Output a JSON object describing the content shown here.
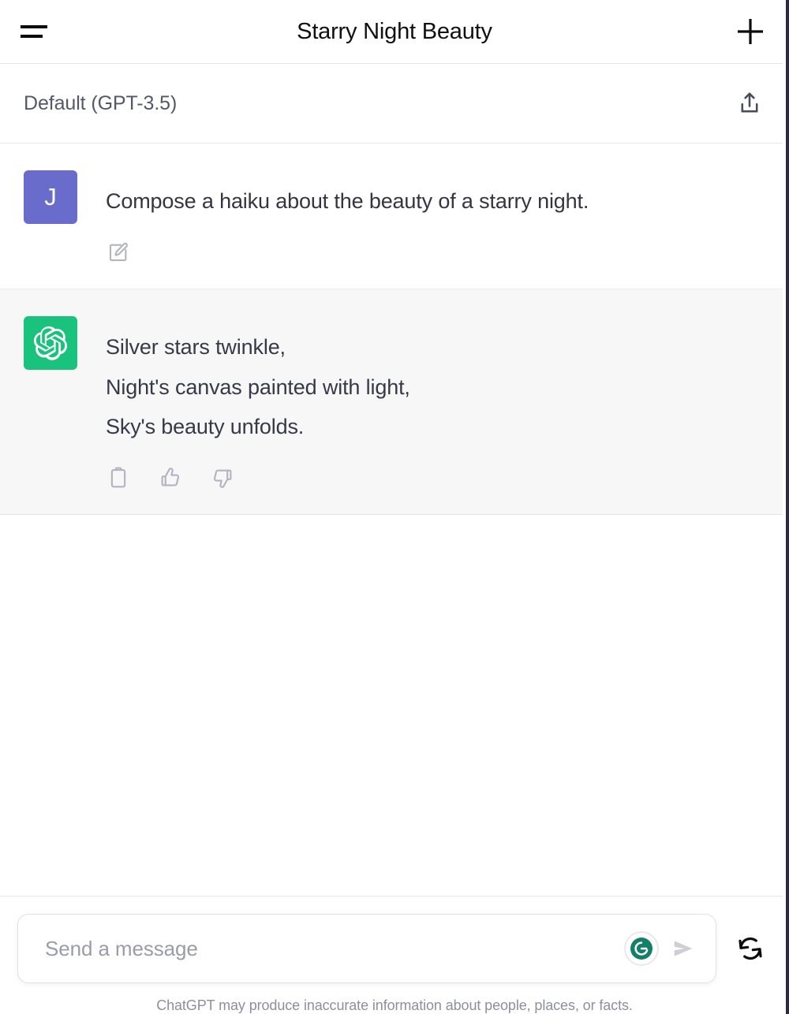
{
  "topbar": {
    "menu_icon": "hamburger-icon",
    "title": "Starry Night Beauty",
    "new_chat_icon": "plus-icon"
  },
  "modelbar": {
    "model_label": "Default (GPT-3.5)",
    "share_icon": "share-icon"
  },
  "conversation": {
    "messages": [
      {
        "role": "user",
        "avatar_initial": "J",
        "avatar_color": "#6a6ccb",
        "lines": [
          "Compose a haiku about the beauty of a starry night."
        ],
        "actions": [
          {
            "name": "edit-message-button",
            "icon": "edit-icon"
          }
        ]
      },
      {
        "role": "assistant",
        "avatar_icon": "openai-logo-icon",
        "avatar_color": "#19c37d",
        "lines": [
          "Silver stars twinkle,",
          "Night's canvas painted with light,",
          "Sky's beauty unfolds."
        ],
        "actions": [
          {
            "name": "copy-button",
            "icon": "clipboard-icon"
          },
          {
            "name": "thumbs-up-button",
            "icon": "thumbs-up-icon"
          },
          {
            "name": "thumbs-down-button",
            "icon": "thumbs-down-icon"
          }
        ]
      }
    ]
  },
  "composer": {
    "placeholder": "Send a message",
    "value": "",
    "grammarly_icon": "grammarly-icon",
    "grammarly_letter": "G",
    "send_icon": "send-arrow-icon",
    "regenerate_icon": "refresh-icon",
    "disclaimer": "ChatGPT may produce inaccurate information about people, places, or facts."
  },
  "colors": {
    "accent_green": "#19c37d",
    "user_avatar": "#6a6ccb",
    "assistant_bg": "#f7f7f8",
    "grammarly_green": "#15806a",
    "text_primary": "#343541",
    "text_secondary": "#565869"
  }
}
